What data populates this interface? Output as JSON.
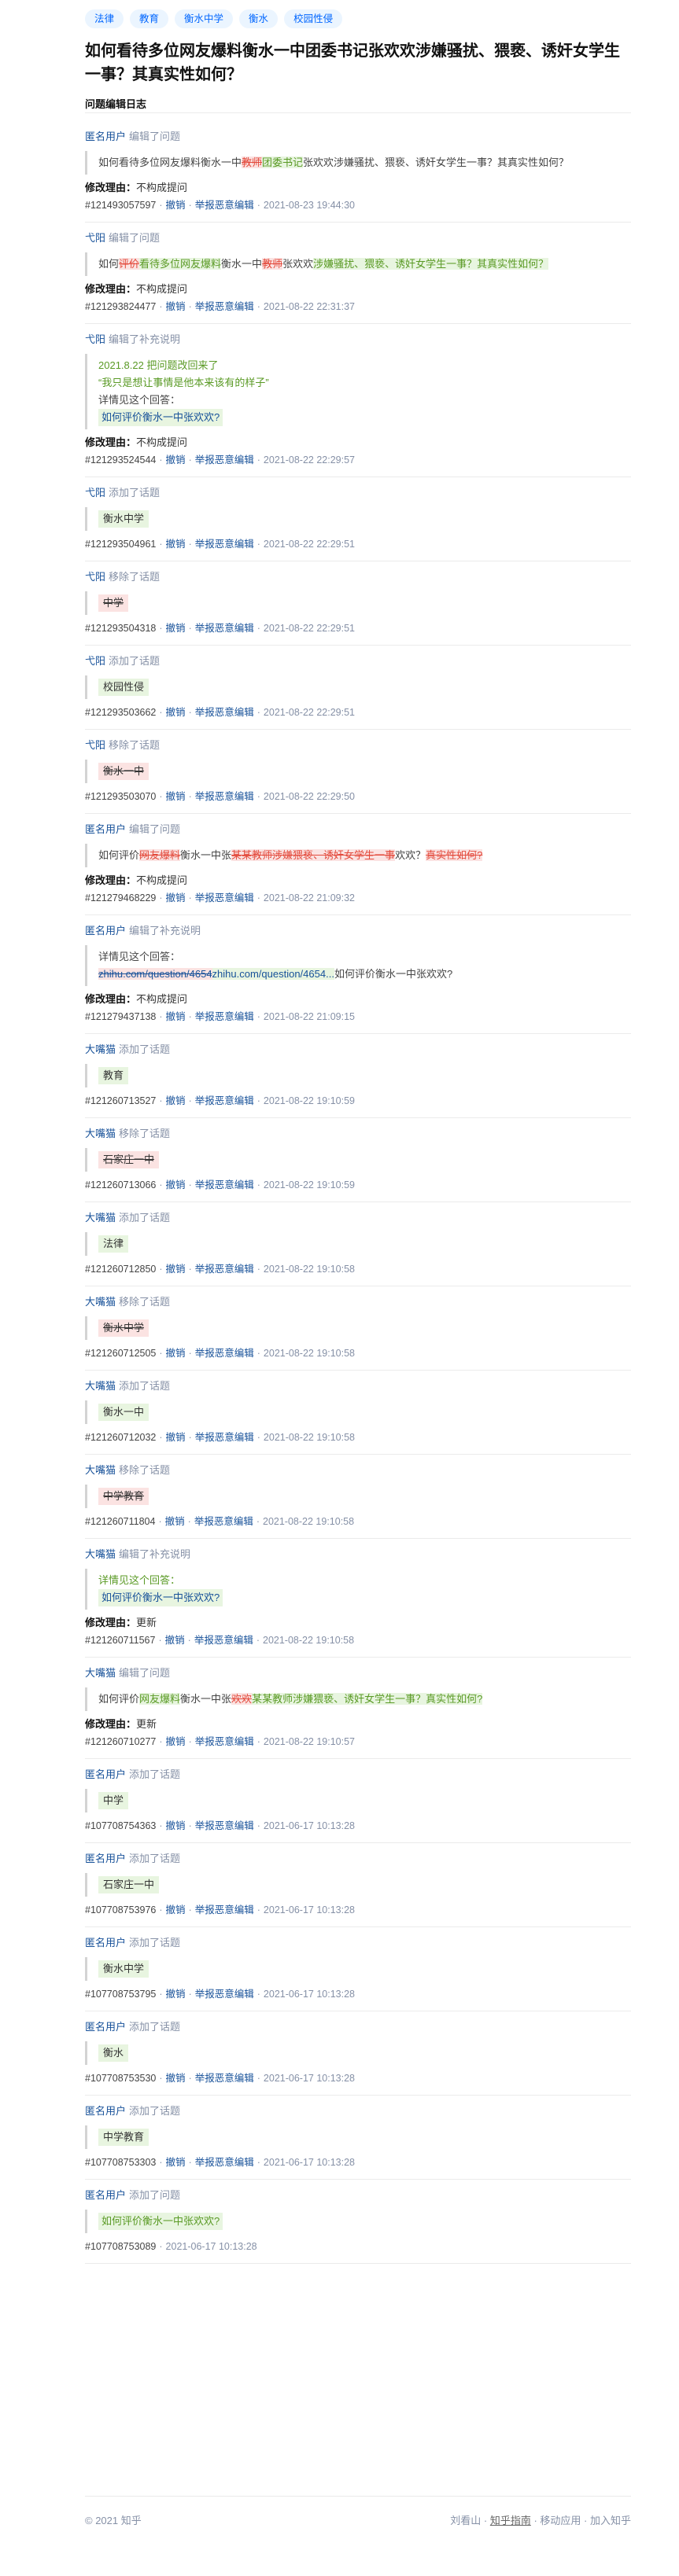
{
  "topics": [
    "法律",
    "教育",
    "衡水中学",
    "衡水",
    "校园性侵"
  ],
  "title": "如何看待多位网友爆料衡水一中团委书记张欢欢涉嫌骚扰、猥亵、诱奸女学生一事？其真实性如何？",
  "log_heading": "问题编辑日志",
  "labels": {
    "reason": "修改理由：",
    "undo": "撤销",
    "report": "举报恶意编辑",
    "dot": "·"
  },
  "entries": [
    {
      "user": "匿名用户",
      "action": "编辑了问题",
      "box_html": "如何看待多位网友爆料衡水一中<span class='del'>教师</span><span class='ins'>团委书记</span>张欢欢涉嫌骚扰、猥亵、诱奸女学生一事？其真实性如何？",
      "reason": "不构成提问",
      "id": "#121493057597",
      "time": "2021-08-23 19:44:30"
    },
    {
      "user": "弋阳",
      "action": "编辑了问题",
      "box_html": "如何<span class='del'>评价</span><span class='ins'>看待多位网友爆料</span>衡水一中<span class='del'>教师</span>张欢欢<span class='ins'>涉嫌骚扰、猥亵、诱奸女学生一事？其真实性如何？</span>",
      "reason": "不构成提问",
      "id": "#121293824477",
      "time": "2021-08-22 22:31:37"
    },
    {
      "user": "弋阳",
      "action": "编辑了补充说明",
      "box_html": "<span class='line' style='color:#5a9a25'>2021.8.22 把问题改回来了</span><span class='line' style='color:#5a9a25'>“我只是想让事情是他本来该有的样子”</span><span class='line'>详情见这个回答：</span><span class='line'><span class='green-line link-line'>如何评价衡水一中张欢欢?</span></span>",
      "reason": "不构成提问",
      "id": "#121293524544",
      "time": "2021-08-22 22:29:57"
    },
    {
      "user": "弋阳",
      "action": "添加了话题",
      "box_html": "<span class='tagchip chip-add'>衡水中学</span>",
      "reason": "",
      "id": "#121293504961",
      "time": "2021-08-22 22:29:51"
    },
    {
      "user": "弋阳",
      "action": "移除了话题",
      "box_html": "<span class='tagchip chip-del'>中学</span>",
      "reason": "",
      "id": "#121293504318",
      "time": "2021-08-22 22:29:51"
    },
    {
      "user": "弋阳",
      "action": "添加了话题",
      "box_html": "<span class='tagchip chip-add'>校园性侵</span>",
      "reason": "",
      "id": "#121293503662",
      "time": "2021-08-22 22:29:51"
    },
    {
      "user": "弋阳",
      "action": "移除了话题",
      "box_html": "<span class='tagchip chip-del'>衡水一中</span>",
      "reason": "",
      "id": "#121293503070",
      "time": "2021-08-22 22:29:50"
    },
    {
      "user": "匿名用户",
      "action": "编辑了问题",
      "box_html": "如何评价<span class='del'>网友爆料</span>衡水一中张<span class='del'>某某教师涉嫌猥亵、诱奸女学生一事</span>欢欢？<span class='del'>真实性如何?</span>",
      "reason": "不构成提问",
      "id": "#121279468229",
      "time": "2021-08-22 21:09:32"
    },
    {
      "user": "匿名用户",
      "action": "编辑了补充说明",
      "box_html": "<span class='line'>详情见这个回答：</span><span class='line'><span class='del' style='color:#175199'>zhihu.com/question/4654</span><span class='ins' style='color:#175199'>zhihu.com/question/4654...</span>如何评价衡水一中张欢欢?</span>",
      "reason": "不构成提问",
      "id": "#121279437138",
      "time": "2021-08-22 21:09:15"
    },
    {
      "user": "大嘴猫",
      "action": "添加了话题",
      "box_html": "<span class='tagchip chip-add'>教育</span>",
      "reason": "",
      "id": "#121260713527",
      "time": "2021-08-22 19:10:59"
    },
    {
      "user": "大嘴猫",
      "action": "移除了话题",
      "box_html": "<span class='tagchip chip-del'>石家庄一中</span>",
      "reason": "",
      "id": "#121260713066",
      "time": "2021-08-22 19:10:59"
    },
    {
      "user": "大嘴猫",
      "action": "添加了话题",
      "box_html": "<span class='tagchip chip-add'>法律</span>",
      "reason": "",
      "id": "#121260712850",
      "time": "2021-08-22 19:10:58"
    },
    {
      "user": "大嘴猫",
      "action": "移除了话题",
      "box_html": "<span class='tagchip chip-del'>衡水中学</span>",
      "reason": "",
      "id": "#121260712505",
      "time": "2021-08-22 19:10:58"
    },
    {
      "user": "大嘴猫",
      "action": "添加了话题",
      "box_html": "<span class='tagchip chip-add'>衡水一中</span>",
      "reason": "",
      "id": "#121260712032",
      "time": "2021-08-22 19:10:58"
    },
    {
      "user": "大嘴猫",
      "action": "移除了话题",
      "box_html": "<span class='tagchip chip-del'>中学教育</span>",
      "reason": "",
      "id": "#121260711804",
      "time": "2021-08-22 19:10:58"
    },
    {
      "user": "大嘴猫",
      "action": "编辑了补充说明",
      "box_html": "<span class='line' style='color:#5a9a25'>详情见这个回答：</span><span class='line'><span class='green-line link-line'>如何评价衡水一中张欢欢?</span></span>",
      "reason": "更新",
      "id": "#121260711567",
      "time": "2021-08-22 19:10:58"
    },
    {
      "user": "大嘴猫",
      "action": "编辑了问题",
      "box_html": "如何评价<span class='ins'>网友爆料</span>衡水一中张<span class='del'>欢欢</span><span class='ins'>某某教师涉嫌猥亵、诱奸女学生一事？真实性如何?</span>",
      "reason": "更新",
      "id": "#121260710277",
      "time": "2021-08-22 19:10:57"
    },
    {
      "user": "匿名用户",
      "action": "添加了话题",
      "box_html": "<span class='tagchip chip-add'>中学</span>",
      "reason": "",
      "id": "#107708754363",
      "time": "2021-06-17 10:13:28"
    },
    {
      "user": "匿名用户",
      "action": "添加了话题",
      "box_html": "<span class='tagchip chip-add'>石家庄一中</span>",
      "reason": "",
      "id": "#107708753976",
      "time": "2021-06-17 10:13:28"
    },
    {
      "user": "匿名用户",
      "action": "添加了话题",
      "box_html": "<span class='tagchip chip-add'>衡水中学</span>",
      "reason": "",
      "id": "#107708753795",
      "time": "2021-06-17 10:13:28"
    },
    {
      "user": "匿名用户",
      "action": "添加了话题",
      "box_html": "<span class='tagchip chip-add'>衡水</span>",
      "reason": "",
      "id": "#107708753530",
      "time": "2021-06-17 10:13:28"
    },
    {
      "user": "匿名用户",
      "action": "添加了话题",
      "box_html": "<span class='tagchip chip-add'>中学教育</span>",
      "reason": "",
      "id": "#107708753303",
      "time": "2021-06-17 10:13:28"
    },
    {
      "user": "匿名用户",
      "action": "添加了问题",
      "box_html": "<span class='green-line'>如何评价衡水一中张欢欢?</span>",
      "reason": "",
      "id": "#107708753089",
      "time": "2021-06-17 10:13:28",
      "no_actions": true
    }
  ],
  "footer": {
    "copyright": "© 2021 知乎",
    "links": [
      "刘看山",
      "知乎指南",
      "移动应用",
      "加入知乎"
    ]
  }
}
